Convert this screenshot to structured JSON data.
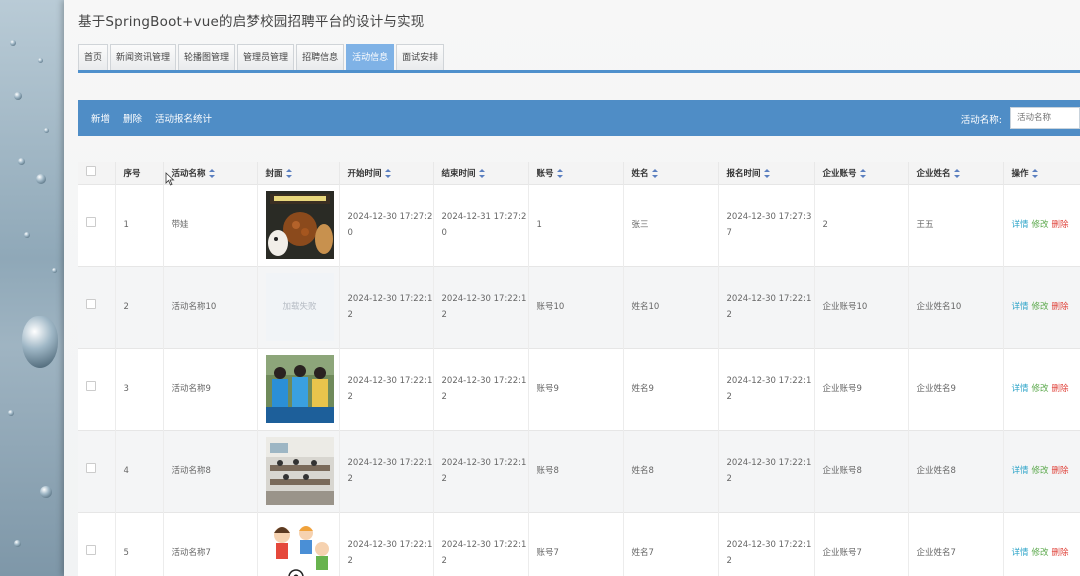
{
  "app": {
    "title": "基于SpringBoot+vue的启梦校园招聘平台的设计与实现"
  },
  "nav": {
    "items": [
      {
        "label": "首页"
      },
      {
        "label": "新闻资讯管理"
      },
      {
        "label": "轮播图管理"
      },
      {
        "label": "管理员管理"
      },
      {
        "label": "招聘信息"
      },
      {
        "label": "活动信息",
        "active": true
      },
      {
        "label": "面试安排"
      }
    ]
  },
  "toolbar": {
    "add_label": "新增",
    "delete_label": "删除",
    "stats_label": "活动报名统计",
    "search_label": "活动名称:",
    "search_placeholder": "活动名称"
  },
  "table": {
    "headers": [
      "序号",
      "活动名称",
      "封面",
      "开始时间",
      "结束时间",
      "账号",
      "姓名",
      "报名时间",
      "企业账号",
      "企业姓名",
      "操作"
    ],
    "rows": [
      {
        "index": "1",
        "name": "带娃",
        "cover": "dog-food-poster",
        "start": "2024-12-30 17:27:20",
        "end": "2024-12-31 17:27:20",
        "account": "1",
        "person": "张三",
        "signup": "2024-12-30 17:27:37",
        "company_account": "2",
        "company_name": "王五"
      },
      {
        "index": "2",
        "name": "活动名称10",
        "cover": "load-failed",
        "cover_text": "加载失败",
        "start": "2024-12-30 17:22:12",
        "end": "2024-12-30 17:22:12",
        "account": "账号10",
        "person": "姓名10",
        "signup": "2024-12-30 17:22:12",
        "company_account": "企业账号10",
        "company_name": "企业姓名10"
      },
      {
        "index": "3",
        "name": "活动名称9",
        "cover": "students-photo",
        "start": "2024-12-30 17:22:12",
        "end": "2024-12-30 17:22:12",
        "account": "账号9",
        "person": "姓名9",
        "signup": "2024-12-30 17:22:12",
        "company_account": "企业账号9",
        "company_name": "企业姓名9"
      },
      {
        "index": "4",
        "name": "活动名称8",
        "cover": "classroom-photo",
        "start": "2024-12-30 17:22:12",
        "end": "2024-12-30 17:22:12",
        "account": "账号8",
        "person": "姓名8",
        "signup": "2024-12-30 17:22:12",
        "company_account": "企业账号8",
        "company_name": "企业姓名8"
      },
      {
        "index": "5",
        "name": "活动名称7",
        "cover": "kids-cartoon",
        "start": "2024-12-30 17:22:12",
        "end": "2024-12-30 17:22:12",
        "account": "账号7",
        "person": "姓名7",
        "signup": "2024-12-30 17:22:12",
        "company_account": "企业账号7",
        "company_name": "企业姓名7"
      }
    ],
    "actions": {
      "detail": "详情",
      "edit": "修改",
      "delete": "删除"
    }
  },
  "colors": {
    "accent": "#4f8dc6",
    "active_tab": "#7fb2e6",
    "detail": "#2fa5c9",
    "edit": "#5aa84b",
    "delete": "#e0443c"
  }
}
